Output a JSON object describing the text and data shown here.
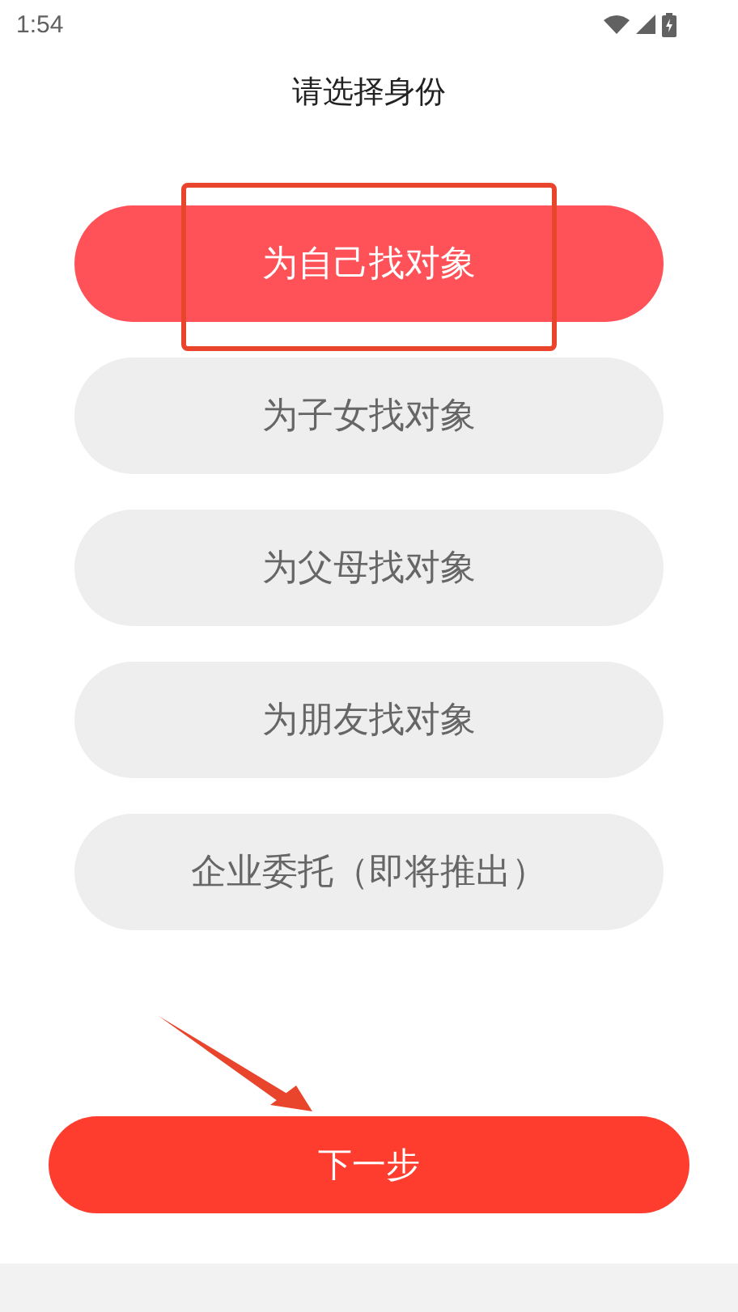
{
  "status_bar": {
    "time": "1:54"
  },
  "title": "请选择身份",
  "options": [
    {
      "label": "为自己找对象",
      "selected": true
    },
    {
      "label": "为子女找对象",
      "selected": false
    },
    {
      "label": "为父母找对象",
      "selected": false
    },
    {
      "label": "为朋友找对象",
      "selected": false
    },
    {
      "label": "企业委托（即将推出）",
      "selected": false
    }
  ],
  "next_button": "下一步"
}
